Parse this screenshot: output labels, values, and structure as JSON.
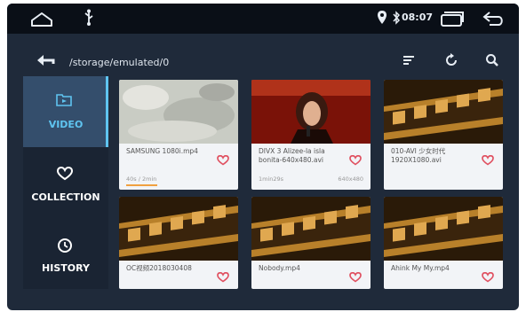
{
  "status": {
    "time": "08:07",
    "icons": [
      "home-icon",
      "usb-icon",
      "location-icon",
      "bluetooth-icon",
      "recent-apps-icon",
      "back-icon"
    ]
  },
  "toolbar": {
    "path": "/storage/emulated/0",
    "icons": [
      "back-arrow-icon",
      "sort-icon",
      "refresh-icon",
      "search-icon"
    ]
  },
  "sidebar": {
    "items": [
      {
        "label": "VIDEO",
        "icon": "video-folder-icon",
        "active": true
      },
      {
        "label": "COLLECTION",
        "icon": "heart-icon",
        "active": false
      },
      {
        "label": "HISTORY",
        "icon": "clock-icon",
        "active": false
      }
    ]
  },
  "videos": [
    {
      "title": "SAMSUNG 1080i.mp4",
      "sub1": "40s / 2min",
      "sub2": "",
      "progress": 0.3
    },
    {
      "title": "DIVX 3 Alizee-la isla bonita-640x480.avi",
      "sub1": "1min29s",
      "sub2": "640x480"
    },
    {
      "title": "010-AVI 少女时代 1920X1080.avi",
      "sub1": "",
      "sub2": ""
    },
    {
      "title": "OC视频2018030408",
      "sub1": "",
      "sub2": ""
    },
    {
      "title": "Nobody.mp4",
      "sub1": "",
      "sub2": ""
    },
    {
      "title": "Ahink My My.mp4",
      "sub1": "",
      "sub2": ""
    }
  ],
  "colors": {
    "accent": "#5fc4f0",
    "heart": "#e05060",
    "background": "#1f2a3a",
    "statusbar": "#0a0f17"
  }
}
